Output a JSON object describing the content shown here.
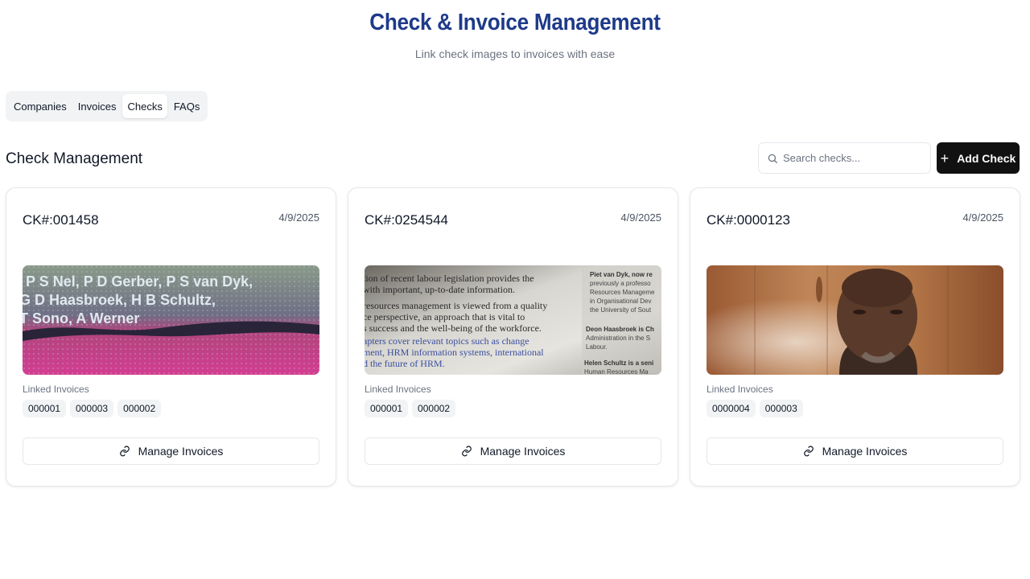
{
  "header": {
    "title": "Check & Invoice Management",
    "subtitle": "Link check images to invoices with ease"
  },
  "tabs": [
    {
      "label": "Companies",
      "active": false
    },
    {
      "label": "Invoices",
      "active": false
    },
    {
      "label": "Checks",
      "active": true
    },
    {
      "label": "FAQs",
      "active": false
    }
  ],
  "section": {
    "title": "Check Management",
    "search_placeholder": "Search checks...",
    "add_label": "Add Check"
  },
  "checks": [
    {
      "number": "CK#:001458",
      "date": "4/9/2025",
      "image_text": [
        "P S Nel, P D Gerber, P S van Dyk,",
        "G D Haasbroek, H B Schultz,",
        "T Sono, A Werner"
      ],
      "linked_label": "Linked Invoices",
      "invoices": [
        "000001",
        "000003",
        "000002"
      ],
      "manage_label": "Manage Invoices"
    },
    {
      "number": "CK#:0254544",
      "date": "4/9/2025",
      "image_text": [
        "tion of recent labour legislation provides the",
        "with important, up-to-date information.",
        "resources management is viewed from a quality",
        "ce perspective, an approach that is vital to",
        "s success and the well-being of the workforce.",
        "apters cover relevant topics such as change",
        "ment, HRM information systems, international",
        "d the future of HRM."
      ],
      "image_side_text": [
        "Piet van Dyk, now re",
        "previously a professo",
        "Resources Manageme",
        "in Organisational Dev",
        "the University of Sout",
        "Deon Haasbroek is Ch",
        "Administration in the S",
        "Labour.",
        "Helen Schultz is a seni",
        "Human Resources Ma"
      ],
      "linked_label": "Linked Invoices",
      "invoices": [
        "000001",
        "000002"
      ],
      "manage_label": "Manage Invoices"
    },
    {
      "number": "CK#:0000123",
      "date": "4/9/2025",
      "linked_label": "Linked Invoices",
      "invoices": [
        "0000004",
        "000003"
      ],
      "manage_label": "Manage Invoices"
    }
  ],
  "icons": {
    "search": "search-icon",
    "add": "plus-icon",
    "link": "link-icon"
  },
  "colors": {
    "title": "#1e3a8a",
    "primary_button": "#111111"
  }
}
